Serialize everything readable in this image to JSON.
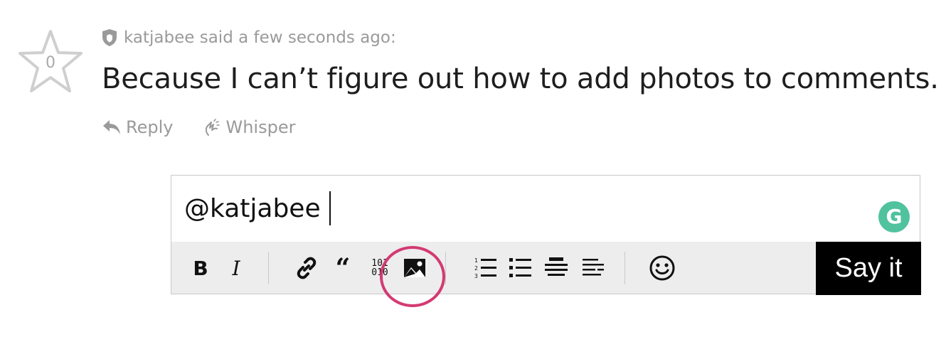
{
  "comment": {
    "star_count": "0",
    "author_line": "katjabee said a few seconds ago:",
    "body": "Because I can’t figure out how to add photos to comments.",
    "reply_label": "Reply",
    "whisper_label": "Whisper"
  },
  "editor": {
    "value": "@katjabee",
    "toolbar": {
      "bold_label": "B",
      "italic_label": "I",
      "quote_label": "“",
      "code_top": "101",
      "code_bottom": "010"
    },
    "grammarly_label": "G",
    "submit_label": "Say it"
  },
  "colors": {
    "accent_highlight": "#d33a72",
    "grammarly": "#50c29e",
    "muted_text": "#9a9a9a"
  },
  "icons": [
    "star-icon",
    "shield-icon",
    "reply-icon",
    "whisper-icon",
    "link-icon",
    "image-icon",
    "ordered-list-icon",
    "unordered-list-icon",
    "align-center-icon",
    "align-right-icon",
    "emoji-icon"
  ]
}
